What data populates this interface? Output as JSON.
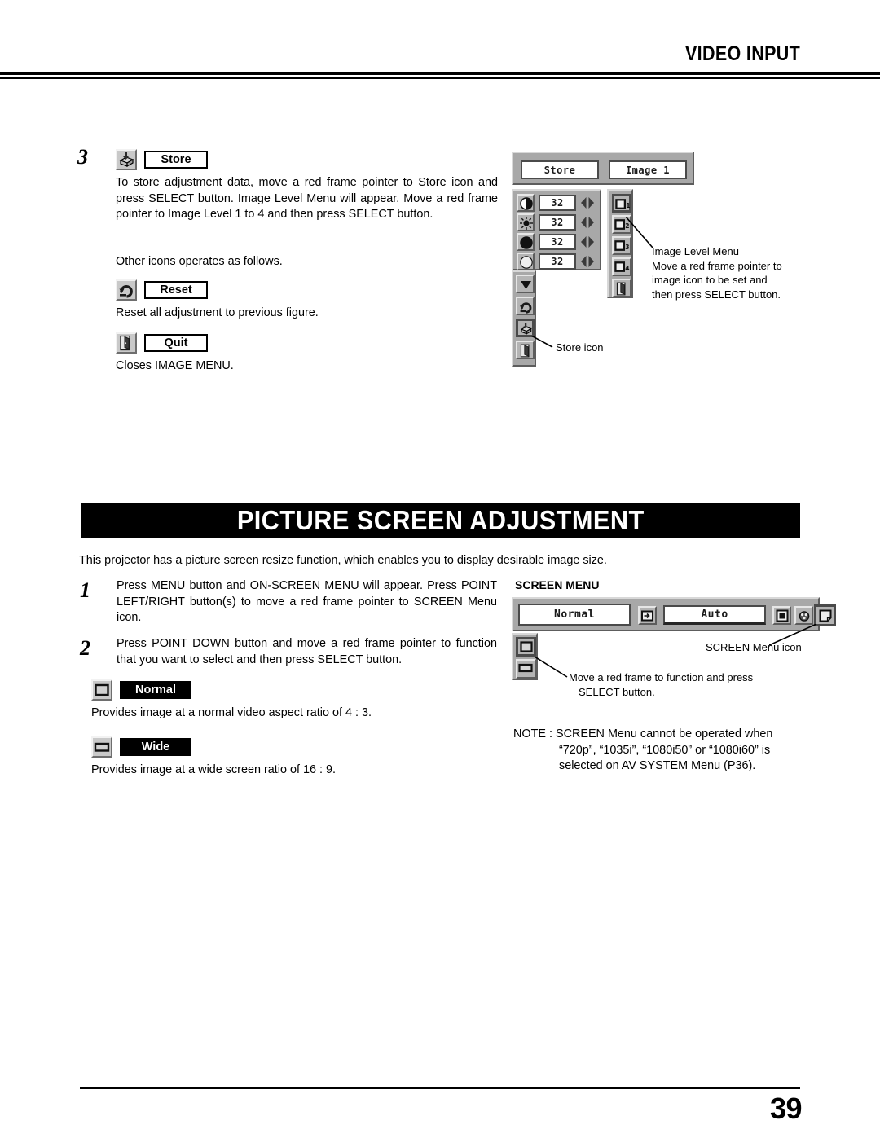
{
  "header": {
    "title": "VIDEO INPUT"
  },
  "image_menu_section": {
    "step_number": "3",
    "store": {
      "icon": "store-icon",
      "label": "Store",
      "description": "To store adjustment data, move a red frame pointer to Store icon and press SELECT button.  Image Level Menu will appear. Move a red frame pointer to Image Level 1 to 4 and then press SELECT button."
    },
    "other_icons_intro": "Other icons operates as follows.",
    "reset": {
      "icon": "reset-icon",
      "label": "Reset",
      "description": "Reset all adjustment to previous figure."
    },
    "quit": {
      "icon": "quit-icon",
      "label": "Quit",
      "description": "Closes IMAGE MENU."
    }
  },
  "image_menu_osd": {
    "header_buttons": [
      "Store",
      "Image 1"
    ],
    "adjust_rows": [
      {
        "icon": "contrast-icon",
        "value": "32"
      },
      {
        "icon": "brightness-icon",
        "value": "32"
      },
      {
        "icon": "color-icon",
        "value": "32"
      },
      {
        "icon": "tint-icon",
        "value": "32"
      }
    ],
    "left_column_icons": [
      "down-arrow-icon",
      "reset-icon",
      "store-icon",
      "quit-icon"
    ],
    "image_level_icons": [
      "image-level-1-icon",
      "image-level-2-icon",
      "image-level-3-icon",
      "image-level-4-icon",
      "quit-icon"
    ],
    "callouts": {
      "image_level_menu": "Image Level Menu\nMove a red frame pointer to\nimage icon to be set and\nthen press SELECT button.",
      "image_level_menu_lines": [
        "Image Level Menu",
        "Move a red frame pointer to",
        "image icon to be set and",
        "then press SELECT button."
      ],
      "store_icon": "Store icon"
    }
  },
  "picture_screen_section": {
    "banner_title": "PICTURE SCREEN ADJUSTMENT",
    "intro": "This projector has a picture screen resize function, which enables you to display desirable image size.",
    "steps": [
      {
        "number": "1",
        "text": "Press MENU button and ON-SCREEN MENU will appear.  Press POINT LEFT/RIGHT button(s) to move a red frame pointer to SCREEN Menu icon."
      },
      {
        "number": "2",
        "text": "Press POINT DOWN button and move a red frame pointer to function that you want to select and then press SELECT button."
      }
    ],
    "options": [
      {
        "icon": "normal-screen-icon",
        "label": "Normal",
        "description": "Provides image at a normal video aspect ratio of 4 : 3."
      },
      {
        "icon": "wide-screen-icon",
        "label": "Wide",
        "description": "Provides image at a wide screen ratio of 16 : 9."
      }
    ]
  },
  "screen_menu_osd": {
    "title": "SCREEN MENU",
    "value_field": "Normal",
    "auto_field": "Auto",
    "bar_icons": [
      "input-icon",
      "square-icon",
      "color-adjust-icon",
      "screen-menu-icon"
    ],
    "dropdown_icons": [
      "normal-screen-icon",
      "wide-screen-icon"
    ],
    "callouts": {
      "screen_menu_icon": "SCREEN Menu icon",
      "move_frame_lines": [
        "Move a red frame to function and press",
        "SELECT button."
      ]
    },
    "note_lines": [
      "NOTE : SCREEN Menu cannot be operated when",
      "“720p”, “1035i”, “1080i50” or “1080i60” is",
      "selected on AV SYSTEM Menu (P36)."
    ]
  },
  "footer": {
    "page_number": "39"
  }
}
